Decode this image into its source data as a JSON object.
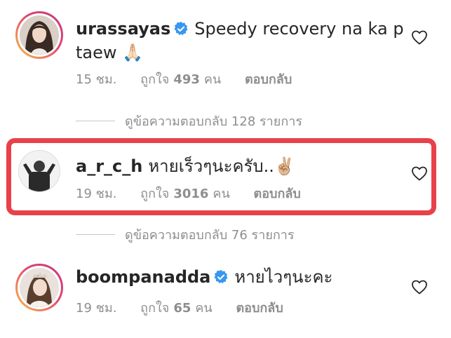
{
  "comments": [
    {
      "username": "urassayas",
      "verified": true,
      "text_line1": "Speedy recovery na ka p",
      "text_line2": "taew 🙏🏻",
      "time": "15 ชม.",
      "likes_prefix": "ถูกใจ",
      "likes_count": "493",
      "likes_suffix": "คน",
      "reply_label": "ตอบกลับ",
      "view_replies": "ดูข้อความตอบกลับ 128 รายการ"
    },
    {
      "username": "a_r_c_h",
      "verified": false,
      "text": "หายเร็วๆนะครับ..✌🏼",
      "time": "19 ชม.",
      "likes_prefix": "ถูกใจ",
      "likes_count": "3016",
      "likes_suffix": "คน",
      "reply_label": "ตอบกลับ",
      "view_replies": "ดูข้อความตอบกลับ 76 รายการ",
      "highlighted": true
    },
    {
      "username": "boompanadda",
      "verified": true,
      "text": "หายไวๆนะคะ",
      "time": "19 ชม.",
      "likes_prefix": "ถูกใจ",
      "likes_count": "65",
      "likes_suffix": "คน",
      "reply_label": "ตอบกลับ"
    }
  ],
  "icons": {
    "like": "heart-outline-icon",
    "verified": "verified-badge-icon"
  },
  "colors": {
    "highlight_border": "#e8414a",
    "verified_blue": "#3897f0",
    "muted_text": "#8e8e8e"
  }
}
